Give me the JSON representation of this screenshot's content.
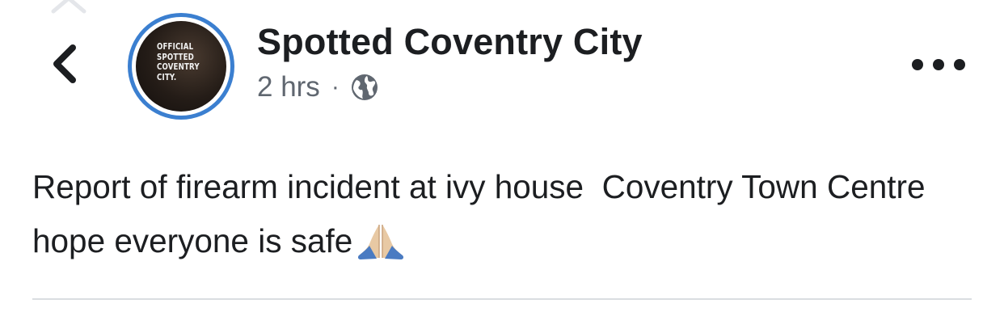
{
  "header": {
    "back_icon": "chevron-left-icon",
    "top_icon": "chevron-up-icon",
    "avatar": {
      "lines": [
        "OFFICIAL",
        "SPOTTED",
        "COVENTRY",
        "CITY."
      ],
      "ring_color": "#3b7fd0"
    },
    "page_name": "Spotted Coventry City",
    "time": "2 hrs",
    "separator": "·",
    "audience_icon": "globe-icon",
    "more_icon": "more-horizontal-icon"
  },
  "post": {
    "text": "Report of firearm incident at ivy house  Coventry Town Centre hope everyone is safe",
    "emoji": "🙏",
    "emoji_icon": "praying-hands-icon"
  },
  "colors": {
    "text": "#1c1e21",
    "meta": "#606770",
    "divider": "#dadde1",
    "accent": "#3b7fd0"
  }
}
